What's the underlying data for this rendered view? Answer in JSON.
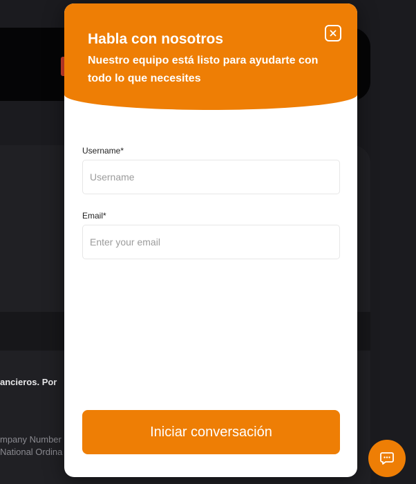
{
  "background": {
    "line1": "ancieros. Por",
    "line2": "mpany Number",
    "line3": "National Ordina"
  },
  "modal": {
    "title": "Habla con nosotros",
    "subtitle": "Nuestro equipo está listo para ayudarte con todo lo que necesites",
    "close_icon": "close-icon",
    "form": {
      "username_label": "Username*",
      "username_placeholder": "Username",
      "username_value": "",
      "email_label": "Email*",
      "email_placeholder": "Enter your email",
      "email_value": ""
    },
    "submit_label": "Iniciar conversación"
  },
  "chat_button": {
    "icon": "chat-bubble-icon"
  },
  "colors": {
    "accent": "#ee7e05",
    "page_bg": "#1b1b1f",
    "modal_bg": "#ffffff"
  }
}
